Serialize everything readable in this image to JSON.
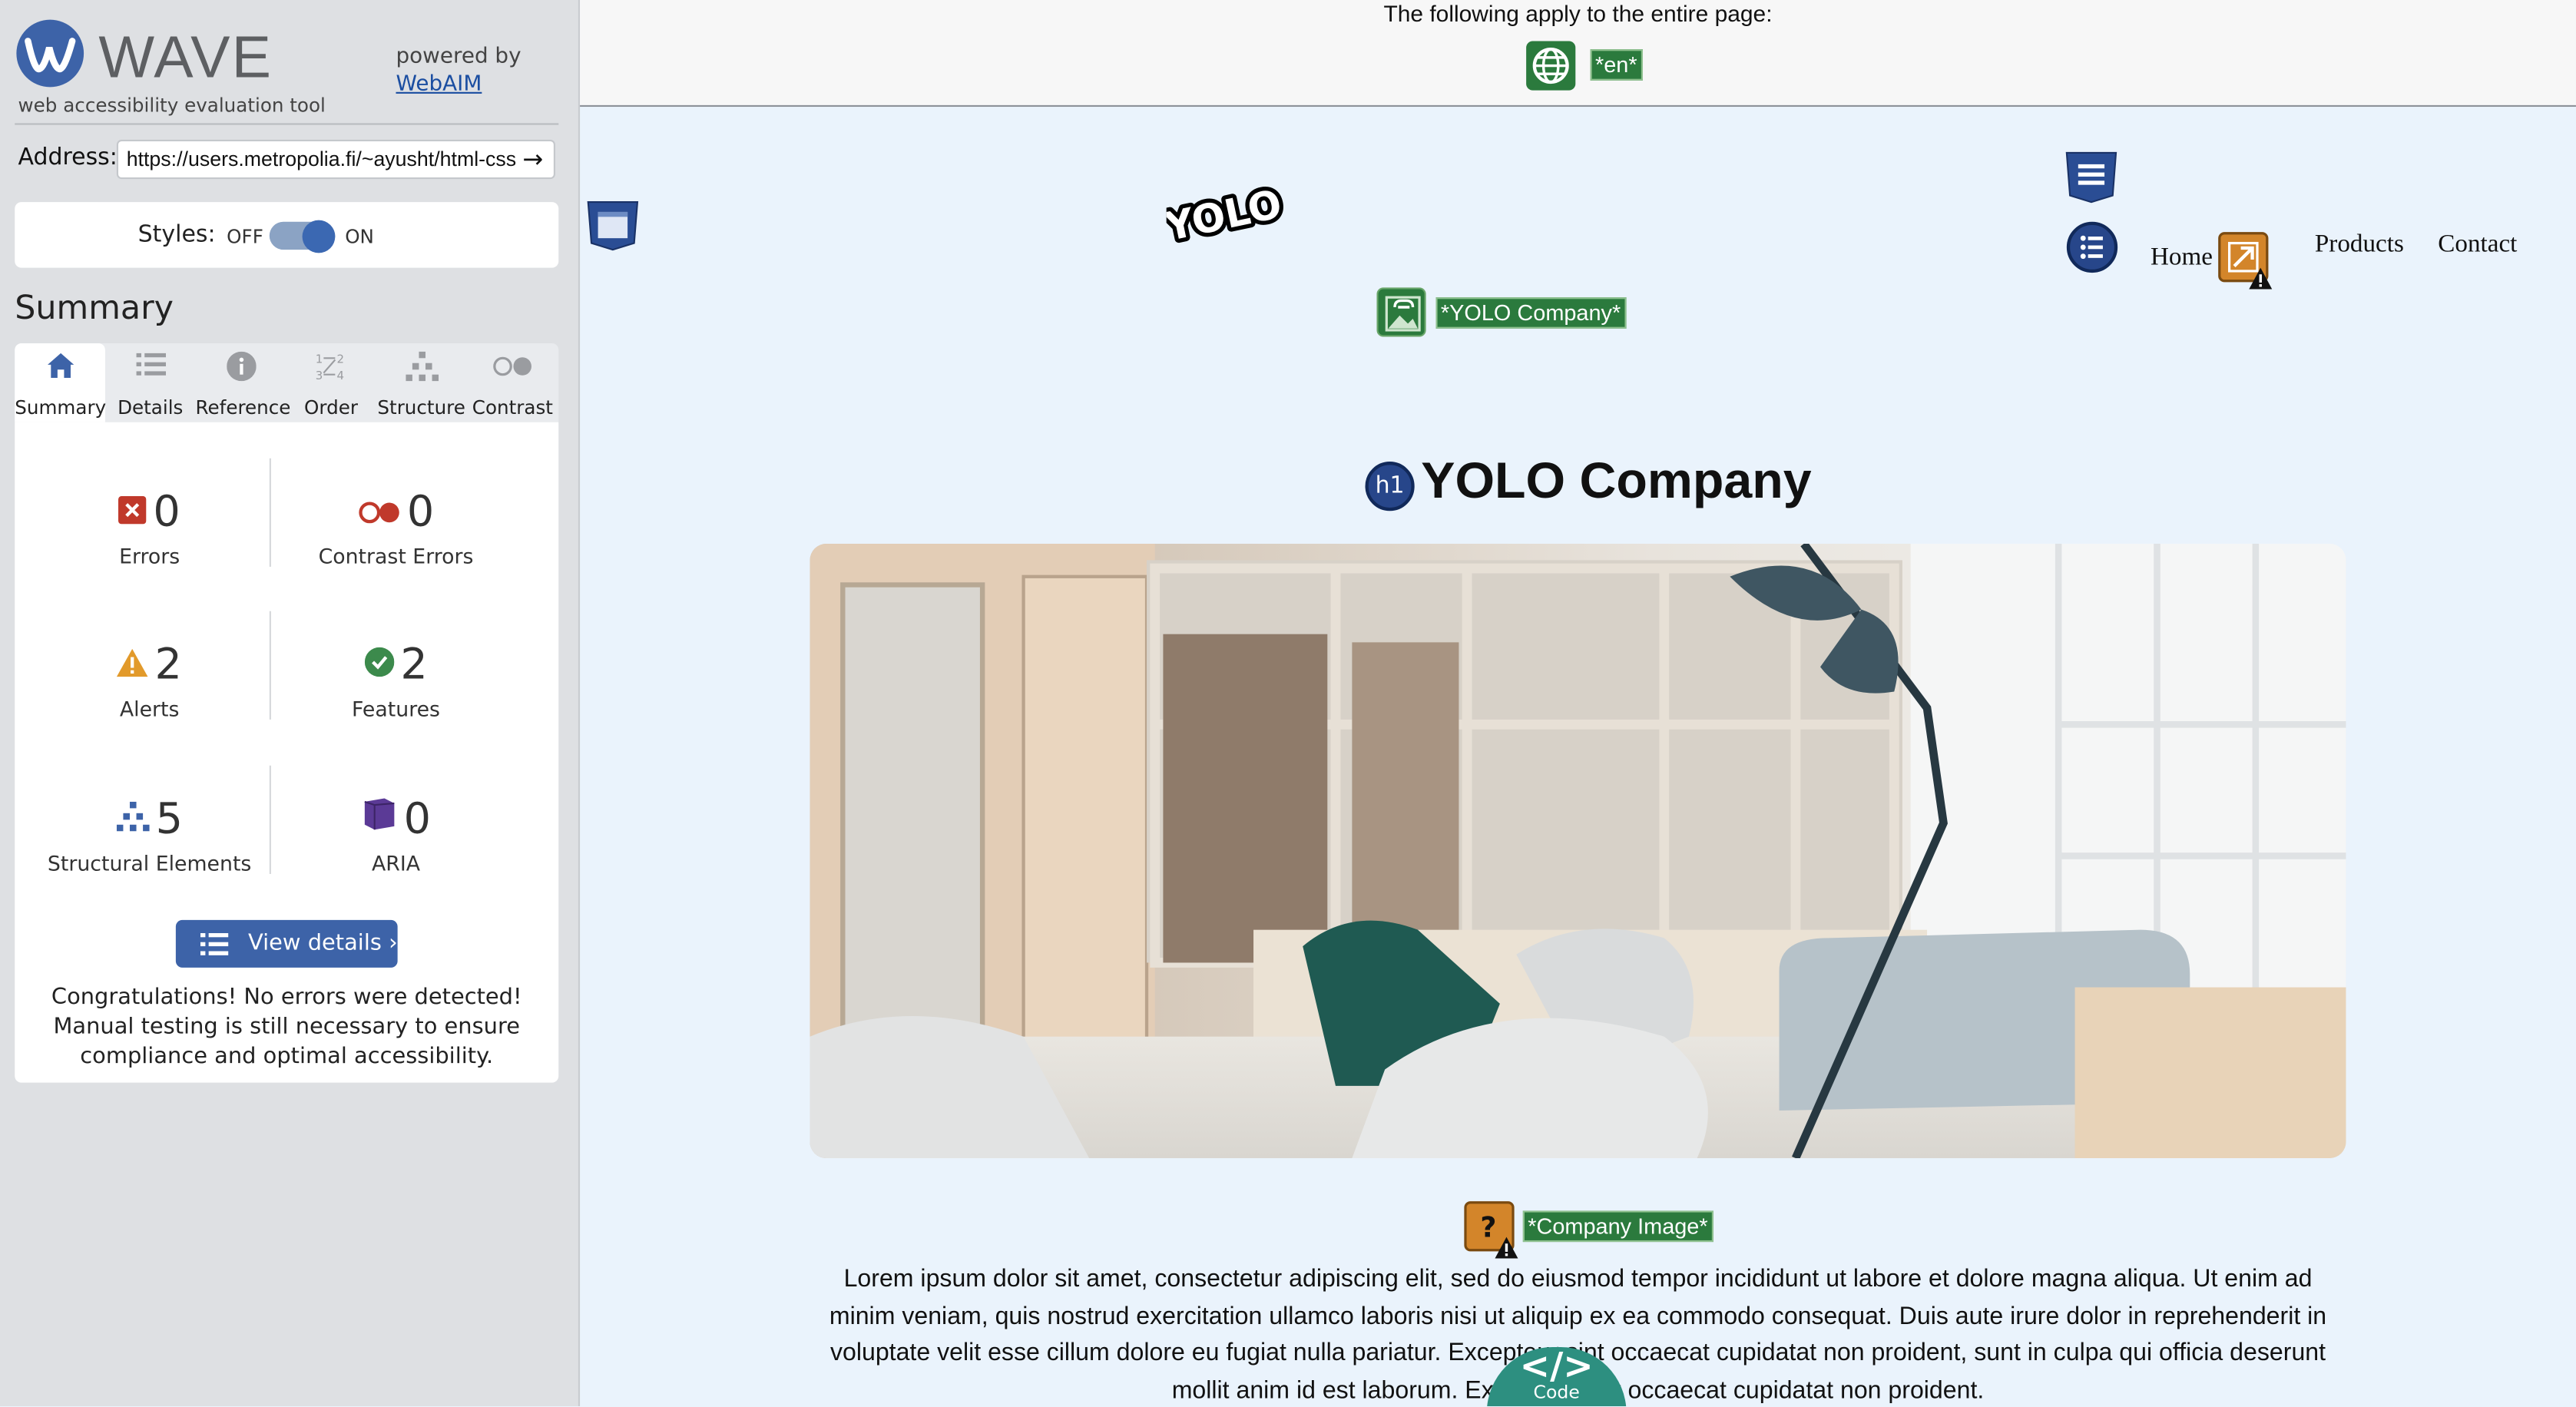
{
  "sidebar": {
    "brand": "WAVE",
    "tagline": "web accessibility evaluation tool",
    "powered_by": "powered by",
    "webaim_link": "WebAIM",
    "address_label": "Address:",
    "address_value": "https://users.metropolia.fi/~ayusht/html-css",
    "styles_label": "Styles:",
    "styles_off": "OFF",
    "styles_on": "ON",
    "styles_enabled": true,
    "summary_heading": "Summary",
    "tabs": [
      {
        "label": "Summary",
        "icon": "home-icon",
        "active": true
      },
      {
        "label": "Details",
        "icon": "list-icon",
        "active": false
      },
      {
        "label": "Reference",
        "icon": "info-icon",
        "active": false
      },
      {
        "label": "Order",
        "icon": "order-icon",
        "active": false
      },
      {
        "label": "Structure",
        "icon": "structure-icon",
        "active": false
      },
      {
        "label": "Contrast",
        "icon": "contrast-icon",
        "active": false
      }
    ],
    "stats": {
      "errors": {
        "value": "0",
        "label": "Errors",
        "color": "#c0392b"
      },
      "contrast_errors": {
        "value": "0",
        "label": "Contrast Errors",
        "color": "#c0392b"
      },
      "alerts": {
        "value": "2",
        "label": "Alerts",
        "color": "#e29a2b"
      },
      "features": {
        "value": "2",
        "label": "Features",
        "color": "#3c8a4c"
      },
      "structural": {
        "value": "5",
        "label": "Structural Elements",
        "color": "#3d63a8"
      },
      "aria": {
        "value": "0",
        "label": "ARIA",
        "color": "#5b3a96"
      }
    },
    "view_details": "View details ›",
    "congrats": "Congratulations! No errors were detected! Manual testing is still necessary to ensure compliance and optimal accessibility."
  },
  "main": {
    "page_notice": "The following apply to the entire page:",
    "lang_label": "*en*",
    "logo_text": "YOLO",
    "link_label": "*YOLO Company*",
    "nav": [
      "Home",
      "Products",
      "Contact"
    ],
    "h1_badge": "h1",
    "heading": "YOLO Company",
    "image_label": "*Company Image*",
    "paragraph": "Lorem ipsum dolor sit amet, consectetur adipiscing elit, sed do eiusmod tempor incididunt ut labore et dolore magna aliqua. Ut enim ad minim veniam, quis nostrud exercitation ullamco laboris nisi ut aliquip ex ea commodo consequat. Duis aute irure dolor in reprehenderit in voluptate velit esse cillum dolore eu fugiat nulla pariatur. Excepteur sint occaecat cupidatat non proident, sunt in culpa qui officia deserunt mollit anim id est laborum. Excepteur sint occaecat cupidatat non proident.",
    "code_button": "</>",
    "code_label": "Code"
  },
  "colors": {
    "wave_blue": "#3d63a8",
    "feature_green": "#2b7a3d",
    "alert_orange": "#d3852a"
  }
}
